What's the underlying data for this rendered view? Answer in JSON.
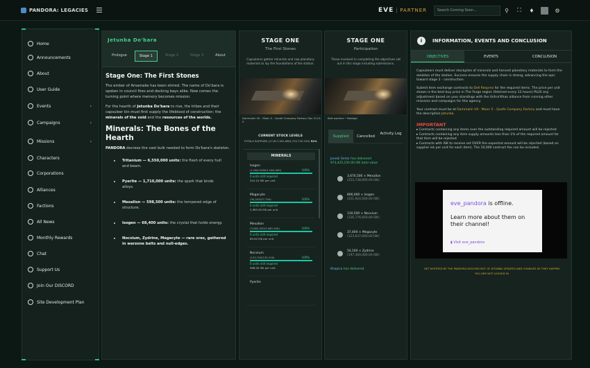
{
  "topbar": {
    "brand": "PANDORA: LEGACIES",
    "eve": "EVE",
    "partner": "PARTNER",
    "search_placeholder": "Search Coming Soon..."
  },
  "sidebar": {
    "items": [
      {
        "label": "Home",
        "icon": "home-icon"
      },
      {
        "label": "Announcements",
        "icon": "megaphone-icon"
      },
      {
        "label": "About",
        "icon": "info-icon"
      },
      {
        "label": "User Guide",
        "icon": "book-icon"
      },
      {
        "label": "Events",
        "icon": "calendar-icon",
        "chevron": true
      },
      {
        "label": "Campaigns",
        "icon": "flag-icon",
        "chevron": true
      },
      {
        "label": "Missions",
        "icon": "target-icon",
        "chevron": true
      },
      {
        "label": "Characters",
        "icon": "user-icon"
      },
      {
        "label": "Corporations",
        "icon": "building-icon"
      },
      {
        "label": "Alliances",
        "icon": "shield-icon"
      },
      {
        "label": "Factions",
        "icon": "faction-icon"
      },
      {
        "label": "All News",
        "icon": "news-icon"
      },
      {
        "label": "Monthly Rewards",
        "icon": "gift-icon"
      },
      {
        "label": "Chat",
        "icon": "chat-icon"
      },
      {
        "label": "Support Us",
        "icon": "heart-icon"
      },
      {
        "label": "Join Our DISCORD",
        "icon": "discord-icon"
      },
      {
        "label": "Site Development Plan",
        "icon": "document-icon"
      }
    ]
  },
  "story": {
    "title": "Jetunba Do'bara",
    "tabs": [
      "Prologue",
      "Stage 1",
      "Stage 2",
      "Stage 3",
      "About"
    ],
    "stage_heading": "Stage One: The First Stones",
    "p1": "The ember of Amamake has been stirred. The name of Do'bara is spoken in council fires and docking bays alike. Now comes the turning point where memory becomes mission.",
    "p2_a": "For the hearth of ",
    "p2_b": "Jetunba Do'bara",
    "p2_c": " to rise, the tribes and their capsuleer kin must first supply the lifeblood of construction: the ",
    "p2_d": "minerals of the void",
    "p2_e": " and the ",
    "p2_f": "resources of the worlds.",
    "minerals_heading": "Minerals: The Bones of the Hearth",
    "p3_a": "PANDORA",
    "p3_b": " decrees the vast bulk needed to form Do'bara's skeleton.",
    "list": [
      {
        "bold": "Tritanium — 6,550,000 units:",
        "text": " the flesh of every hull and beam."
      },
      {
        "bold": "Pyerite — 1,710,000 units:",
        "text": " the spark that binds alloys."
      },
      {
        "bold": "Mexallon — 598,500 units:",
        "text": " the tempered edge of structure."
      },
      {
        "bold": "Isogen — 68,400 units:",
        "text": " the crystal that holds energy."
      },
      {
        "bold": "Nocxium, Zydrine, Megacyte — rare ores, gathered in warzone belts and null-edges.",
        "text": ""
      }
    ]
  },
  "stage_a": {
    "title": "STAGE ONE",
    "subtitle": "The First Stones",
    "desc": "Capsuleers gather minerals and raw planetary materials to lay the foundations of the station.",
    "caption": "Dammalin VII - Moon 5 - Quafe Company Factory Gas 3-0-0-0",
    "stock_title": "CURRENT STOCK LEVELS",
    "stock_sub": "TOTALS SUPPLIED (17,617,001.68/5,725,720.230)",
    "stock_pct": "92%",
    "minerals_label": "MINERALS",
    "minerals": [
      {
        "name": "Isogen",
        "qty": "(1,064,0280/1,064,060)",
        "pct": "100%",
        "still": "0 units still required",
        "price": "310.10 ISK per unit",
        "fill": 1.0
      },
      {
        "name": "Megacyte",
        "qty": "(30,205/37,700)",
        "pct": "100%",
        "still": "0 units still required",
        "price": "3,383.00 ISK per unit",
        "fill": 1.0
      },
      {
        "name": "Mexallon",
        "qty": "(3,062,500/3,062,500)",
        "pct": "100%",
        "still": "0 units still required",
        "price": "69.00 ISK per unit",
        "fill": 1.0
      },
      {
        "name": "Nocxium",
        "qty": "(130,700/130,700)",
        "pct": "100%",
        "still": "0 units still required",
        "price": "968.00 ISK per unit",
        "fill": 1.0
      },
      {
        "name": "Pyerite",
        "qty": "",
        "pct": "",
        "still": "",
        "price": "",
        "fill": 0
      }
    ]
  },
  "stage_b": {
    "title": "STAGE ONE",
    "subtitle": "Participation",
    "desc": "Those involved in completing the objectives set out in this stage including submissions.",
    "caption": "Bolt workers • Bodega",
    "tabs": [
      "Supplied",
      "Cancelled",
      "Activity Log"
    ],
    "activity": {
      "who": "Joonbi Sintar",
      "action": " has delivered",
      "total": "973,425,250.00 ISK total value",
      "items": [
        {
          "name": "3,670,500 × Mexallon",
          "isk": "(253,738,000.00 ISK)"
        },
        {
          "name": "806,000 × Isogen",
          "isk": "(251,924,500.00 ISK)"
        },
        {
          "name": "130,500 × Nocxium",
          "isk": "(126,776,650.00 ISK)"
        },
        {
          "name": "37,400 × Megacyte",
          "isk": "(123,637,000.00 ISK)"
        },
        {
          "name": "54,100 × Zydrine",
          "isk": "(197,360,000.00 ISK)"
        }
      ],
      "who2": "Khapica",
      "action2": " has delivered"
    }
  },
  "info": {
    "title": "INFORMATION, EVENTS AND CONCLUSION",
    "tabs": [
      "OBJECTIVES",
      "EVENTS",
      "CONCLUSION"
    ],
    "p1": "Capsuleers must deliver stockpiles of minerals and harvest planetary materials to form the skeleton of the station. Success ensures the supply chain is strong, advancing the epic toward stage 2 - construction.",
    "p2_a": "Submit item exchange contracts to ",
    "p2_b": "Dell Rexprex",
    "p2_c": " for the required items. The price per unit shown is the best buy price in The Forge region (fetched every 12 hours) PLUS any adjustment based on your standings with the Ushra'Khan alliance from running other missions and campaigns for this agency.",
    "p3_a": "Your contract must be at ",
    "p3_b": "Dammalin VII - Moon 5 - Quafe Company Factory",
    "p3_c": " and must have the description ",
    "p3_d": "Jetunba",
    "important": "IMPORTANT",
    "rules": [
      "Contracts containing any items over the outstanding required amount will be rejected",
      "Contracts containing any item supply amounts less than 1% of the required amount for that item will be rejected",
      "Contracts with ISK to receive set OVER the expected amount will be rejected (based on supplier isk per unit for each item). The 10,000 contract fee can be included."
    ],
    "twitch_channel": "eve_pandora",
    "twitch_offline": " is offline.",
    "twitch_body": "Learn more about them on their channel!",
    "twitch_link": "Visit eve_pandora",
    "notify1": "GET NOTIFIED BY THE PANDORA DISCORD BOT OF JETUNBA UPDATES AND CHANGES AS THEY HAPPEN",
    "notify2": "YOU ARE NOT LOGGED IN"
  }
}
